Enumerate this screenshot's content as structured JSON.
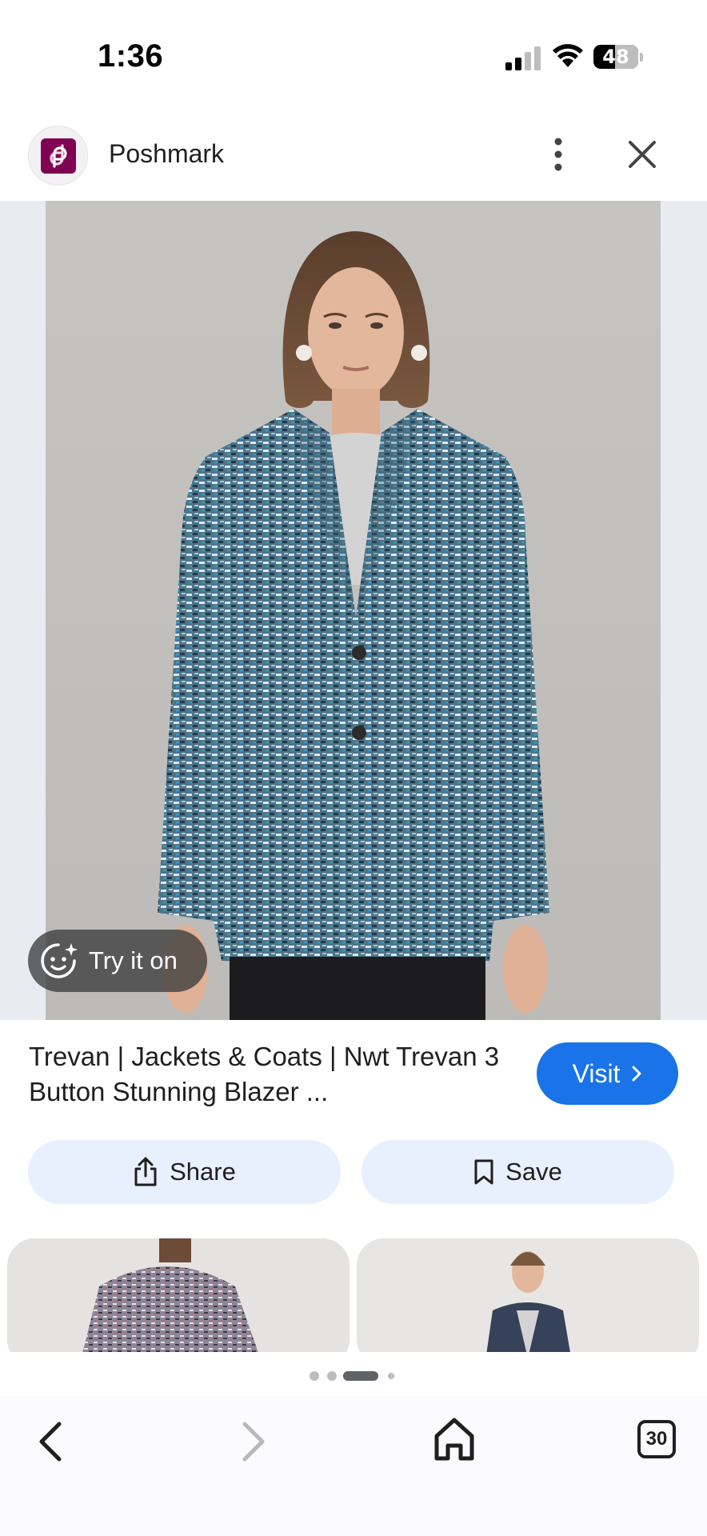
{
  "status_bar": {
    "time": "1:36",
    "battery_level": "48",
    "signal_bars_active": 2,
    "signal_bars_total": 4,
    "icons": [
      "signal-icon",
      "wifi-icon",
      "battery-icon"
    ]
  },
  "header": {
    "site_name": "Poshmark",
    "logo_icon": "poshmark-logo-icon",
    "brand_color": "#7f0353",
    "menu_icon": "more-vert-icon",
    "close_icon": "close-icon"
  },
  "main_image": {
    "try_on_label": "Try it on",
    "try_on_icon": "face-sparkle-icon"
  },
  "product": {
    "title": "Trevan | Jackets & Coats | Nwt Trevan 3 Button Stunning Blazer ...",
    "visit_label": "Visit",
    "visit_color": "#1a73e8"
  },
  "actions": {
    "share_label": "Share",
    "save_label": "Save",
    "share_icon": "share-icon",
    "save_icon": "bookmark-icon"
  },
  "pager": {
    "dot_count": 4,
    "active_index": 2
  },
  "bottom_nav": {
    "tab_count": "30",
    "icons": [
      "back-icon",
      "forward-icon",
      "home-icon",
      "tabs-icon"
    ]
  }
}
